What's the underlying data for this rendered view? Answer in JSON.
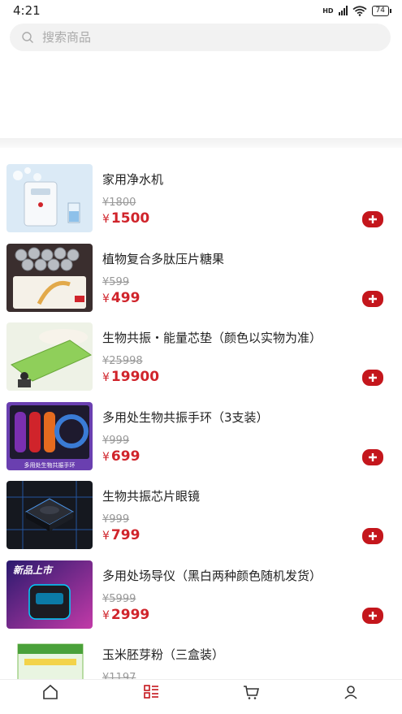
{
  "status": {
    "time": "4:21",
    "network": "HD",
    "battery": "74"
  },
  "search": {
    "placeholder": "搜索商品"
  },
  "products": [
    {
      "name": "家用净水机",
      "old_price": "¥1800",
      "price": "1500",
      "currency": "¥",
      "thumb_icon": "water-purifier"
    },
    {
      "name": "植物复合多肽压片糖果",
      "old_price": "¥599",
      "price": "499",
      "currency": "¥",
      "thumb_icon": "candy-tablets"
    },
    {
      "name": "生物共振・能量芯垫（颜色以实物为准）",
      "old_price": "¥25998",
      "price": "19900",
      "currency": "¥",
      "thumb_icon": "energy-mat"
    },
    {
      "name": "多用处生物共振手环（3支装）",
      "old_price": "¥999",
      "price": "699",
      "currency": "¥",
      "thumb_icon": "bracelets",
      "thumb_caption": "多用处生物共振手环"
    },
    {
      "name": "生物共振芯片眼镜",
      "old_price": "¥999",
      "price": "799",
      "currency": "¥",
      "thumb_icon": "chip-glasses"
    },
    {
      "name": "多用处场导仪（黑白两种颜色随机发货）",
      "old_price": "¥5999",
      "price": "2999",
      "currency": "¥",
      "thumb_icon": "field-device",
      "thumb_caption": "新品上市"
    },
    {
      "name": "玉米胚芽粉（三盒装）",
      "old_price": "¥1197",
      "price": "",
      "currency": "¥",
      "thumb_icon": "corn-germ-powder"
    }
  ],
  "tabbar": [
    {
      "icon": "home-icon"
    },
    {
      "icon": "category-icon"
    },
    {
      "icon": "cart-icon"
    },
    {
      "icon": "user-icon"
    }
  ],
  "colors": {
    "accent": "#c4161c",
    "price": "#d0242b"
  }
}
